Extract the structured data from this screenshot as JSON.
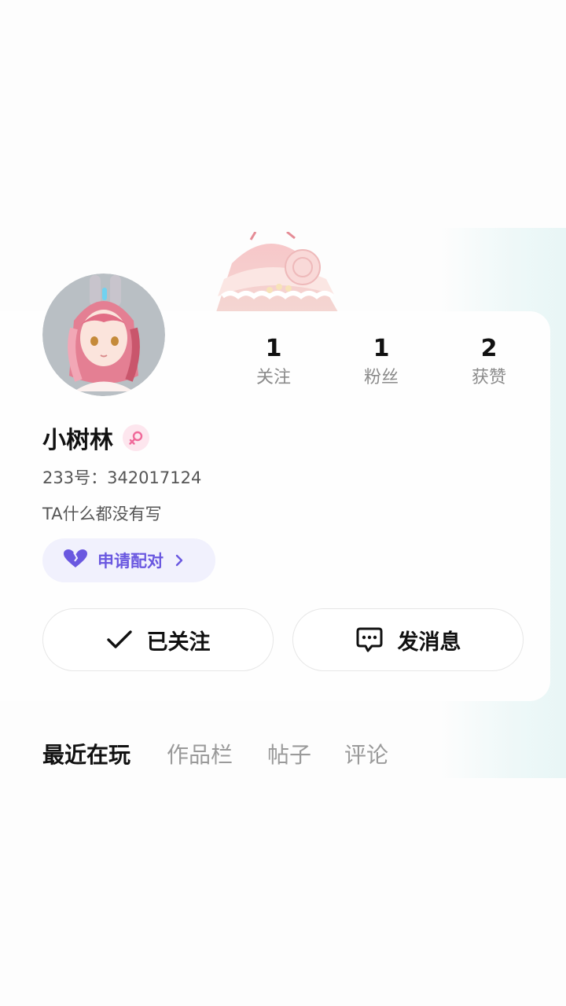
{
  "profile": {
    "name": "小树林",
    "gender": "female",
    "uid_text": "233号：342017124",
    "bio": "TA什么都没有写"
  },
  "stats": [
    {
      "value": "1",
      "label": "关注"
    },
    {
      "value": "1",
      "label": "粉丝"
    },
    {
      "value": "2",
      "label": "获赞"
    }
  ],
  "pair_button": {
    "label": "申请配对",
    "icon": "heart-icon"
  },
  "actions": {
    "follow_label": "已关注",
    "message_label": "发消息"
  },
  "tabs": [
    {
      "label": "最近在玩",
      "active": true
    },
    {
      "label": "作品栏",
      "active": false
    },
    {
      "label": "帖子",
      "active": false
    },
    {
      "label": "评论",
      "active": false
    }
  ],
  "colors": {
    "accent": "#6a58e0",
    "pair_bg": "#f1f1fd",
    "gender_pink": "#f06a9a",
    "muted_text": "#8a8a8a"
  }
}
